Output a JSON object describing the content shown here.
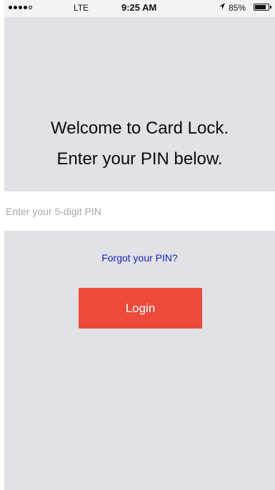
{
  "status_bar": {
    "carrier": "LTE",
    "time": "9:25 AM",
    "location_icon": "location-arrow-icon",
    "battery_percent": "85%",
    "battery_level": 0.85,
    "signal_bars_filled": 4,
    "signal_bars_total": 5
  },
  "welcome": {
    "line1": "Welcome to Card Lock.",
    "line2": "Enter your PIN below."
  },
  "pin_input": {
    "placeholder": "Enter your 5-digit PIN",
    "value": ""
  },
  "forgot_link": "Forgot your PIN?",
  "login_button": "Login",
  "colors": {
    "background": "#e1e2e5",
    "link": "#1a22cc",
    "button": "#ed4a3b",
    "button_text": "#ffffff"
  }
}
